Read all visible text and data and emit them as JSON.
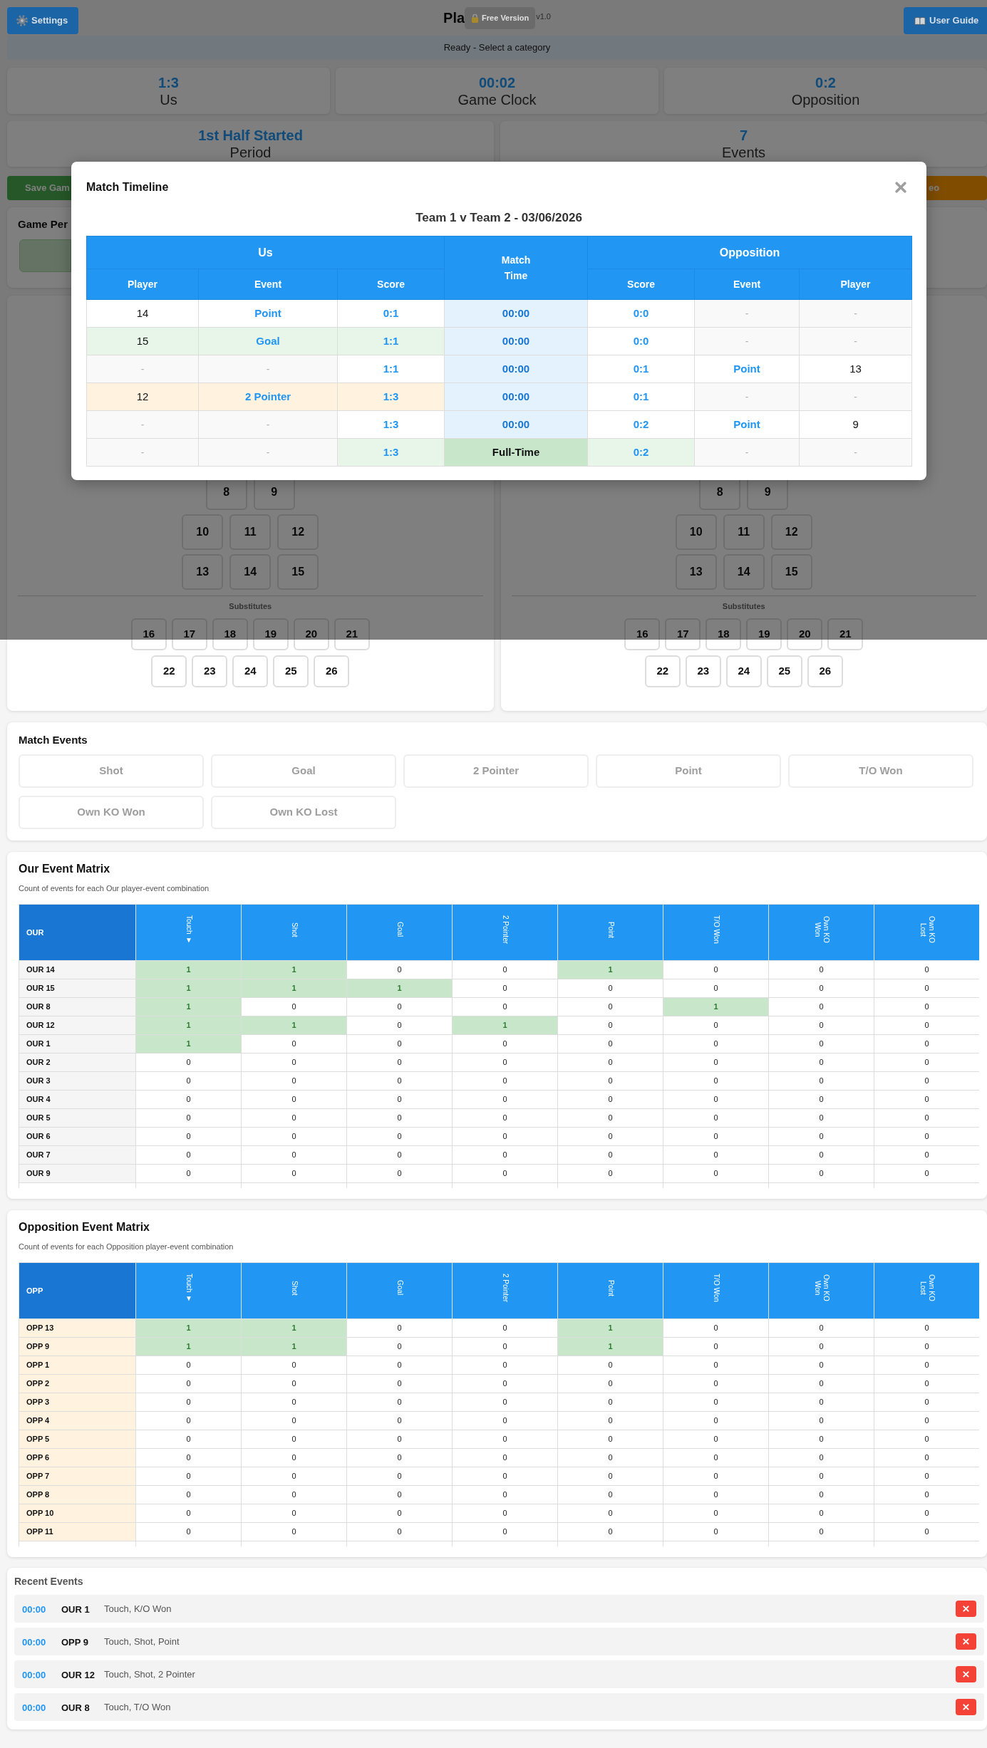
{
  "header": {
    "settings_button": "Settings",
    "title": "Pla",
    "badge": "Free Version",
    "version": "v1.0",
    "guide_button": "User Guide"
  },
  "status_bar": "Ready - Select a category",
  "score_cards": [
    {
      "value": "1:3",
      "label": "Us"
    },
    {
      "value": "00:02",
      "label": "Game Clock"
    },
    {
      "value": "0:2",
      "label": "Opposition"
    }
  ],
  "info_cards": [
    {
      "value": "1st Half Started",
      "label": "Period"
    },
    {
      "value": "7",
      "label": "Events"
    }
  ],
  "action_buttons": [
    "Save Gam",
    "eo"
  ],
  "game_period": {
    "title": "Game Per",
    "buttons": [
      {
        "selected": true
      }
    ]
  },
  "teams": [
    {
      "formation_rows": [
        [
          "8",
          "9"
        ],
        [
          "10",
          "11",
          "12"
        ],
        [
          "13",
          "14",
          "15"
        ]
      ],
      "substitutes_label": "Substitutes",
      "substitute_rows": [
        [
          "16",
          "17",
          "18",
          "19",
          "20",
          "21"
        ],
        [
          "22",
          "23",
          "24",
          "25",
          "26"
        ]
      ]
    },
    {
      "formation_rows": [
        [
          "8",
          "9"
        ],
        [
          "10",
          "11",
          "12"
        ],
        [
          "13",
          "14",
          "15"
        ]
      ],
      "substitutes_label": "Substitutes",
      "substitute_rows": [
        [
          "16",
          "17",
          "18",
          "19",
          "20",
          "21"
        ],
        [
          "22",
          "23",
          "24",
          "25",
          "26"
        ]
      ]
    }
  ],
  "match_events": {
    "title": "Match Events",
    "buttons": [
      {
        "label": "Shot",
        "disabled": true
      },
      {
        "label": "Goal",
        "disabled": true
      },
      {
        "label": "2 Pointer",
        "disabled": true
      },
      {
        "label": "Point",
        "disabled": true
      },
      {
        "label": "T/O Won",
        "disabled": true
      },
      {
        "label": "Own KO Won",
        "disabled": true
      },
      {
        "label": "Own KO Lost",
        "disabled": true
      }
    ]
  },
  "our_matrix": {
    "kind": "our",
    "title": "Our Event Matrix",
    "subtitle": "Count of events for each Our player-event combination",
    "corner": "OUR",
    "columns": [
      "Touch ▼",
      "Shot",
      "Goal",
      "2 Pointer",
      "Point",
      "T/O Won",
      "Own KO Won",
      "Own KO Lost"
    ],
    "rows": [
      {
        "player": "OUR 14",
        "counts": [
          "1",
          "1",
          "0",
          "0",
          "1",
          "0",
          "0",
          "0"
        ],
        "highlighted": [
          true,
          true,
          false,
          false,
          true,
          false,
          false,
          false
        ]
      },
      {
        "player": "OUR 15",
        "counts": [
          "1",
          "1",
          "1",
          "0",
          "0",
          "0",
          "0",
          "0"
        ],
        "highlighted": [
          true,
          true,
          true,
          false,
          false,
          false,
          false,
          false
        ]
      },
      {
        "player": "OUR 8",
        "counts": [
          "1",
          "0",
          "0",
          "0",
          "0",
          "1",
          "0",
          "0"
        ],
        "highlighted": [
          true,
          false,
          false,
          false,
          false,
          true,
          false,
          false
        ]
      },
      {
        "player": "OUR 12",
        "counts": [
          "1",
          "1",
          "0",
          "1",
          "0",
          "0",
          "0",
          "0"
        ],
        "highlighted": [
          true,
          true,
          false,
          true,
          false,
          false,
          false,
          false
        ]
      },
      {
        "player": "OUR 1",
        "counts": [
          "1",
          "0",
          "0",
          "0",
          "0",
          "0",
          "0",
          "0"
        ],
        "highlighted": [
          true,
          false,
          false,
          false,
          false,
          false,
          false,
          false
        ]
      },
      {
        "player": "OUR 2",
        "counts": [
          "0",
          "0",
          "0",
          "0",
          "0",
          "0",
          "0",
          "0"
        ],
        "highlighted": [
          false,
          false,
          false,
          false,
          false,
          false,
          false,
          false
        ]
      },
      {
        "player": "OUR 3",
        "counts": [
          "0",
          "0",
          "0",
          "0",
          "0",
          "0",
          "0",
          "0"
        ],
        "highlighted": [
          false,
          false,
          false,
          false,
          false,
          false,
          false,
          false
        ]
      },
      {
        "player": "OUR 4",
        "counts": [
          "0",
          "0",
          "0",
          "0",
          "0",
          "0",
          "0",
          "0"
        ],
        "highlighted": [
          false,
          false,
          false,
          false,
          false,
          false,
          false,
          false
        ]
      },
      {
        "player": "OUR 5",
        "counts": [
          "0",
          "0",
          "0",
          "0",
          "0",
          "0",
          "0",
          "0"
        ],
        "highlighted": [
          false,
          false,
          false,
          false,
          false,
          false,
          false,
          false
        ]
      },
      {
        "player": "OUR 6",
        "counts": [
          "0",
          "0",
          "0",
          "0",
          "0",
          "0",
          "0",
          "0"
        ],
        "highlighted": [
          false,
          false,
          false,
          false,
          false,
          false,
          false,
          false
        ]
      },
      {
        "player": "OUR 7",
        "counts": [
          "0",
          "0",
          "0",
          "0",
          "0",
          "0",
          "0",
          "0"
        ],
        "highlighted": [
          false,
          false,
          false,
          false,
          false,
          false,
          false,
          false
        ]
      },
      {
        "player": "OUR 9",
        "counts": [
          "0",
          "0",
          "0",
          "0",
          "0",
          "0",
          "0",
          "0"
        ],
        "highlighted": [
          false,
          false,
          false,
          false,
          false,
          false,
          false,
          false
        ]
      }
    ]
  },
  "opposition_matrix": {
    "kind": "opposition",
    "title": "Opposition Event Matrix",
    "subtitle": "Count of events for each Opposition player-event combination",
    "corner": "OPP",
    "columns": [
      "Touch ▼",
      "Shot",
      "Goal",
      "2 Pointer",
      "Point",
      "T/O Won",
      "Own KO Won",
      "Own KO Lost"
    ],
    "rows": [
      {
        "player": "OPP 13",
        "counts": [
          "1",
          "1",
          "0",
          "0",
          "1",
          "0",
          "0",
          "0"
        ],
        "highlighted": [
          true,
          true,
          false,
          false,
          true,
          false,
          false,
          false
        ]
      },
      {
        "player": "OPP 9",
        "counts": [
          "1",
          "1",
          "0",
          "0",
          "1",
          "0",
          "0",
          "0"
        ],
        "highlighted": [
          true,
          true,
          false,
          false,
          true,
          false,
          false,
          false
        ]
      },
      {
        "player": "OPP 1",
        "counts": [
          "0",
          "0",
          "0",
          "0",
          "0",
          "0",
          "0",
          "0"
        ],
        "highlighted": [
          false,
          false,
          false,
          false,
          false,
          false,
          false,
          false
        ]
      },
      {
        "player": "OPP 2",
        "counts": [
          "0",
          "0",
          "0",
          "0",
          "0",
          "0",
          "0",
          "0"
        ],
        "highlighted": [
          false,
          false,
          false,
          false,
          false,
          false,
          false,
          false
        ]
      },
      {
        "player": "OPP 3",
        "counts": [
          "0",
          "0",
          "0",
          "0",
          "0",
          "0",
          "0",
          "0"
        ],
        "highlighted": [
          false,
          false,
          false,
          false,
          false,
          false,
          false,
          false
        ]
      },
      {
        "player": "OPP 4",
        "counts": [
          "0",
          "0",
          "0",
          "0",
          "0",
          "0",
          "0",
          "0"
        ],
        "highlighted": [
          false,
          false,
          false,
          false,
          false,
          false,
          false,
          false
        ]
      },
      {
        "player": "OPP 5",
        "counts": [
          "0",
          "0",
          "0",
          "0",
          "0",
          "0",
          "0",
          "0"
        ],
        "highlighted": [
          false,
          false,
          false,
          false,
          false,
          false,
          false,
          false
        ]
      },
      {
        "player": "OPP 6",
        "counts": [
          "0",
          "0",
          "0",
          "0",
          "0",
          "0",
          "0",
          "0"
        ],
        "highlighted": [
          false,
          false,
          false,
          false,
          false,
          false,
          false,
          false
        ]
      },
      {
        "player": "OPP 7",
        "counts": [
          "0",
          "0",
          "0",
          "0",
          "0",
          "0",
          "0",
          "0"
        ],
        "highlighted": [
          false,
          false,
          false,
          false,
          false,
          false,
          false,
          false
        ]
      },
      {
        "player": "OPP 8",
        "counts": [
          "0",
          "0",
          "0",
          "0",
          "0",
          "0",
          "0",
          "0"
        ],
        "highlighted": [
          false,
          false,
          false,
          false,
          false,
          false,
          false,
          false
        ]
      },
      {
        "player": "OPP 10",
        "counts": [
          "0",
          "0",
          "0",
          "0",
          "0",
          "0",
          "0",
          "0"
        ],
        "highlighted": [
          false,
          false,
          false,
          false,
          false,
          false,
          false,
          false
        ]
      },
      {
        "player": "OPP 11",
        "counts": [
          "0",
          "0",
          "0",
          "0",
          "0",
          "0",
          "0",
          "0"
        ],
        "highlighted": [
          false,
          false,
          false,
          false,
          false,
          false,
          false,
          false
        ]
      }
    ]
  },
  "recent_events": {
    "title": "Recent Events",
    "items": [
      {
        "time": "00:00",
        "player": "OUR 1",
        "description": "Touch, K/O Won"
      },
      {
        "time": "00:00",
        "player": "OPP 9",
        "description": "Touch, Shot, Point"
      },
      {
        "time": "00:00",
        "player": "OUR 12",
        "description": "Touch, Shot, 2 Pointer"
      },
      {
        "time": "00:00",
        "player": "OUR 8",
        "description": "Touch, T/O Won"
      }
    ]
  },
  "modal": {
    "title": "Match Timeline",
    "subtitle": "Team 1 v Team 2 - 03/06/2026",
    "group_headers": [
      "Us",
      "Match Time",
      "Opposition"
    ],
    "columns": [
      "Player",
      "Event",
      "Score",
      "Score",
      "Event",
      "Player"
    ],
    "rows": [
      {
        "us": {
          "kind": "event",
          "player": "14",
          "event": "Point",
          "score": "0:1"
        },
        "time": {
          "kind": "clock",
          "text": "00:00"
        },
        "opposition": {
          "kind": "blank",
          "player": "-",
          "event": "-",
          "score": "0:0"
        }
      },
      {
        "us": {
          "kind": "event",
          "color": "#e8f5e9",
          "player": "15",
          "event": "Goal",
          "score": "1:1"
        },
        "time": {
          "kind": "clock",
          "text": "00:00"
        },
        "opposition": {
          "kind": "blank",
          "player": "-",
          "event": "-",
          "score": "0:0"
        }
      },
      {
        "us": {
          "kind": "blank",
          "player": "-",
          "event": "-",
          "score": "1:1"
        },
        "time": {
          "kind": "clock",
          "text": "00:00"
        },
        "opposition": {
          "kind": "event",
          "player": "13",
          "event": "Point",
          "score": "0:1"
        }
      },
      {
        "us": {
          "kind": "event",
          "color": "#fff3e0",
          "player": "12",
          "event": "2 Pointer",
          "score": "1:3"
        },
        "time": {
          "kind": "clock",
          "text": "00:00"
        },
        "opposition": {
          "kind": "blank",
          "player": "-",
          "event": "-",
          "score": "0:1"
        }
      },
      {
        "us": {
          "kind": "blank",
          "player": "-",
          "event": "-",
          "score": "1:3"
        },
        "time": {
          "kind": "clock",
          "text": "00:00"
        },
        "opposition": {
          "kind": "event",
          "player": "9",
          "event": "Point",
          "score": "0:2"
        }
      },
      {
        "us": {
          "kind": "blank",
          "color": "#e8f5e9",
          "player": "-",
          "event": "-",
          "score": "1:3"
        },
        "time": {
          "kind": "full_time",
          "text": "Full-Time"
        },
        "opposition": {
          "kind": "blank",
          "color": "#e8f5e9",
          "player": "-",
          "event": "-",
          "score": "0:2"
        }
      }
    ]
  }
}
